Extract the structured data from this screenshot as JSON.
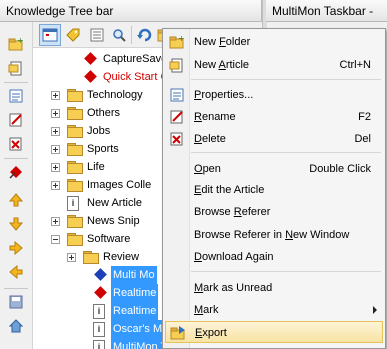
{
  "panels": {
    "left_title": "Knowledge Tree bar",
    "right_title": "MultiMon Taskbar - Ma"
  },
  "toolbar": {
    "top_icons": [
      "calendar-icon",
      "tag-icon",
      "list-icon",
      "search-icon",
      "refresh-icon",
      "folder-icon"
    ],
    "side_icons": [
      "new-folder-icon",
      "new-article-icon",
      "properties-icon",
      "rename-icon",
      "delete-icon",
      "pin-icon",
      "up-arrow-icon",
      "down-arrow-icon",
      "right-arrow-icon",
      "left-arrow-icon",
      "disk-icon",
      "home-icon"
    ]
  },
  "tree": {
    "items": [
      {
        "label": "CaptureSaver",
        "type": "red-diamond"
      },
      {
        "label": "Quick Start G",
        "type": "red-diamond",
        "red": true
      },
      {
        "label": "Technology",
        "type": "folder"
      },
      {
        "label": "Others",
        "type": "folder"
      },
      {
        "label": "Jobs",
        "type": "folder"
      },
      {
        "label": "Sports",
        "type": "folder"
      },
      {
        "label": "Life",
        "type": "folder"
      },
      {
        "label": "Images Colle",
        "type": "folder"
      },
      {
        "label": "New Article",
        "type": "doc"
      },
      {
        "label": "News Snip",
        "type": "folder"
      },
      {
        "label": "Software",
        "type": "folder"
      },
      {
        "label": "Review",
        "type": "folder"
      },
      {
        "label": "Multi Mo",
        "type": "blue-diamond",
        "selected": true
      },
      {
        "label": "Realtime",
        "type": "red-diamond",
        "selected": true
      },
      {
        "label": "Realtime",
        "type": "doc",
        "selected": true
      },
      {
        "label": "Oscar's M",
        "type": "doc",
        "selected": true
      },
      {
        "label": "MultiMon Taskbar - Mu",
        "type": "doc",
        "selected": true
      }
    ]
  },
  "context_menu": {
    "items": [
      {
        "label": "New Folder",
        "shortcut": "",
        "icon": "new-folder-icon"
      },
      {
        "label": "New Article",
        "shortcut": "Ctrl+N",
        "icon": "new-article-icon"
      },
      {
        "label": "Properties...",
        "shortcut": "",
        "icon": "properties-icon"
      },
      {
        "label": "Rename",
        "shortcut": "F2",
        "icon": "rename-icon"
      },
      {
        "label": "Delete",
        "shortcut": "Del",
        "icon": "delete-icon"
      },
      {
        "label": "Open",
        "shortcut": "Double Click",
        "icon": ""
      },
      {
        "label": "Edit the Article",
        "shortcut": "",
        "icon": ""
      },
      {
        "label": "Browse Referer",
        "shortcut": "",
        "icon": ""
      },
      {
        "label": "Browse Referer in New Window",
        "shortcut": "",
        "icon": ""
      },
      {
        "label": "Download Again",
        "shortcut": "",
        "icon": ""
      },
      {
        "label": "Mark as Unread",
        "shortcut": "",
        "icon": ""
      },
      {
        "label": "Mark",
        "shortcut": "",
        "icon": ""
      },
      {
        "label": "Export",
        "shortcut": "",
        "icon": "export-icon"
      }
    ]
  },
  "colors": {
    "selection": "#3399ff",
    "menu_highlight": "#f8e3a3",
    "red_text": "#d00000"
  }
}
